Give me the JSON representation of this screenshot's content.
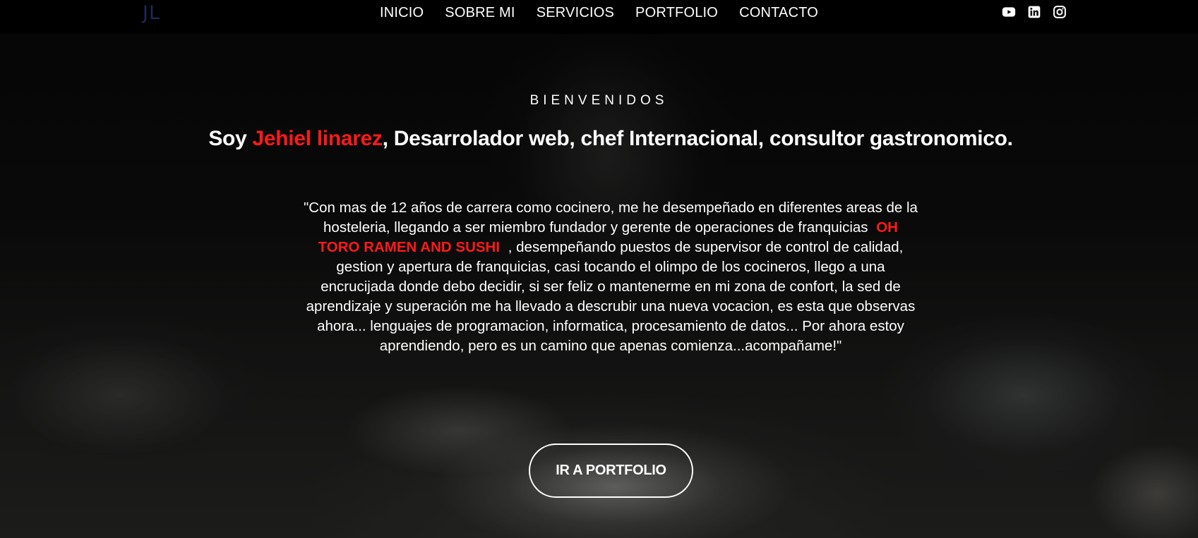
{
  "nav": {
    "logo": "JL",
    "links": [
      "INICIO",
      "SOBRE MI",
      "SERVICIOS",
      "PORTFOLIO",
      "CONTACTO"
    ],
    "social_icons": [
      "youtube-icon",
      "linkedin-icon",
      "instagram-icon"
    ]
  },
  "hero": {
    "welcome": "BIENVENIDOS",
    "headline": {
      "prefix": "Soy ",
      "name": "Jehiel linarez",
      "suffix": ", Desarrolador web, chef Internacional, consultor gastronomico."
    },
    "bio": {
      "before": "\"Con mas de 12 años de carrera como cocinero, me he desempeñado en diferentes areas de la hosteleria, llegando a ser miembro fundador y gerente de operaciones de franquicias",
      "highlight": "OH TORO RAMEN AND SUSHI",
      "after": ", desempeñando puestos de supervisor de control de calidad, gestion y apertura de franquicias, casi tocando el olimpo de los cocineros, llego a una encrucijada donde debo decidir, si ser feliz o mantenerme en mi zona de confort, la sed de aprendizaje y superación me ha llevado a descrubir una nueva vocacion, es esta que observas ahora... lenguajes de programacion, informatica, procesamiento de datos... Por ahora estoy aprendiendo, pero es un camino que apenas comienza...acompañame!\""
    },
    "cta_label": "IR A PORTFOLIO"
  },
  "colors": {
    "accent": "#ff1a1a",
    "logo": "#1e2a5c",
    "navbar_bg": "#000000",
    "text": "#ffffff"
  }
}
